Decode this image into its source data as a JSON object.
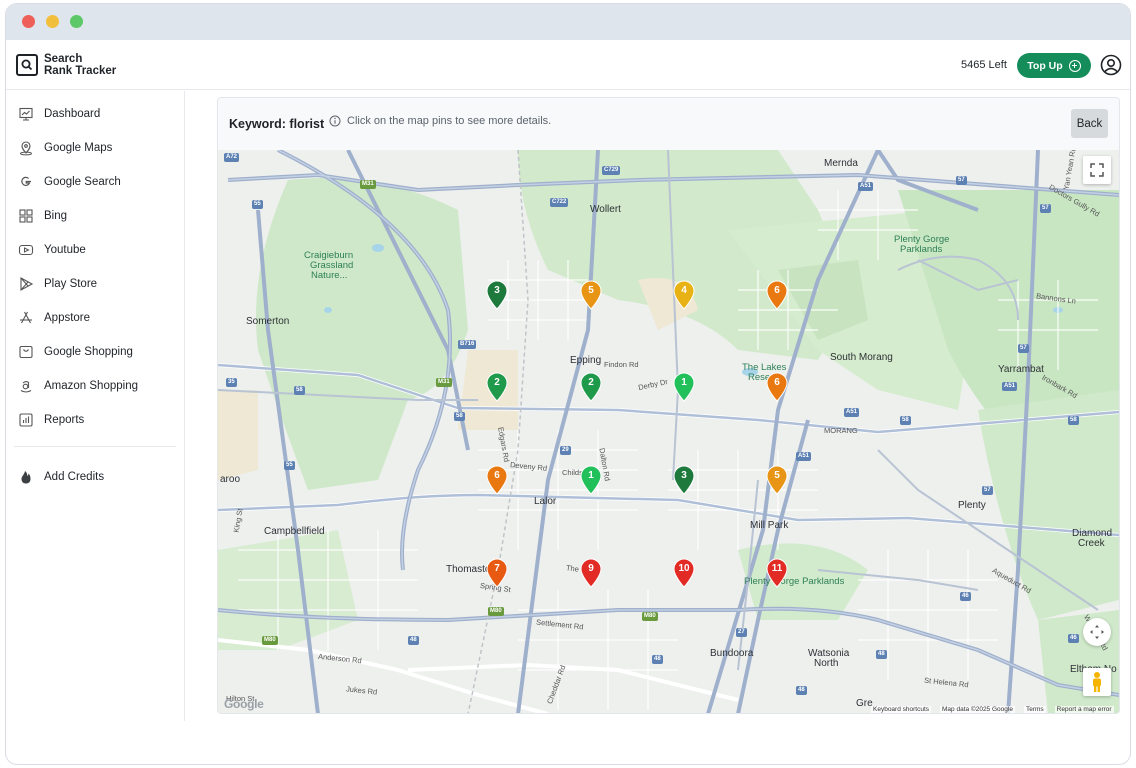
{
  "brand": {
    "line1": "Search",
    "line2": "Rank Tracker"
  },
  "header": {
    "credits": "5465 Left",
    "topup_label": "Top Up"
  },
  "sidebar": {
    "items": [
      {
        "label": "Dashboard",
        "icon": "dashboard-icon"
      },
      {
        "label": "Google Maps",
        "icon": "map-pin-icon"
      },
      {
        "label": "Google Search",
        "icon": "google-icon"
      },
      {
        "label": "Bing",
        "icon": "bing-icon"
      },
      {
        "label": "Youtube",
        "icon": "youtube-icon"
      },
      {
        "label": "Play Store",
        "icon": "play-store-icon"
      },
      {
        "label": "Appstore",
        "icon": "appstore-icon"
      },
      {
        "label": "Google Shopping",
        "icon": "shopping-icon"
      },
      {
        "label": "Amazon Shopping",
        "icon": "amazon-icon"
      },
      {
        "label": "Reports",
        "icon": "reports-icon"
      }
    ],
    "add_credits": {
      "label": "Add Credits",
      "icon": "flame-icon"
    }
  },
  "panel": {
    "keyword": "Keyword: florist",
    "hint": "Click on the map pins to see more details.",
    "back_label": "Back"
  },
  "map": {
    "places": {
      "wollert": "Wollert",
      "mernda": "Mernda",
      "craigieburn": "Craigieburn",
      "grassland1": "Grassland",
      "nature": "Nature...",
      "somerton": "Somerton",
      "epping": "Epping",
      "south_morang": "South Morang",
      "the_lakes": "The Lakes",
      "reserve": "Reserve",
      "yarrambat": "Yarrambat",
      "plenty_gorge1": "Plenty Gorge",
      "parklands1": "Parklands",
      "lalor": "Lalor",
      "mill_park": "Mill Park",
      "plenty": "Plenty",
      "diamond": "Diamond",
      "creek": "Creek",
      "campbellfield": "Campbellfield",
      "aroo": "aroo",
      "thomastown": "Thomastown",
      "plenty_gorge_parklands": "Plenty Gorge Parklands",
      "bundoora": "Bundoora",
      "watsonia": "Watsonia",
      "north": "North",
      "eltham": "Eltham No",
      "morang": "MORANG",
      "gre": "Gre"
    },
    "streets": {
      "findon": "Findon Rd",
      "derby": "Derby Dr",
      "deveny": "Deveny Rd",
      "childs": "Childs",
      "edgars": "Edgars Rd",
      "dalton": "Dalton Rd",
      "settlement": "Settlement Rd",
      "anderson": "Anderson Rd",
      "jukes": "Jukes Rd",
      "cheddar": "Cheddar Rd",
      "spring": "Spring St",
      "the": "The",
      "king": "King St",
      "hilton": "Hilton St",
      "bannons": "Bannons Ln",
      "ironbark": "Ironbark Rd",
      "doctors_gully": "Doctors Gully Rd",
      "yan_yean": "Yan Yean Rd",
      "aqueduct": "Aqueduct Rd",
      "st_helena": "St Helena Rd",
      "weidlich": "Weidlich Rd"
    },
    "shields": [
      "M31",
      "M31",
      "M80",
      "M80",
      "M80",
      "A72",
      "C729",
      "C722",
      "B716",
      "A51",
      "A51",
      "A51",
      "A51",
      "35",
      "55",
      "55",
      "58",
      "58",
      "58",
      "58",
      "29",
      "27",
      "57",
      "57",
      "57",
      "57",
      "46",
      "46",
      "48",
      "48",
      "48",
      "48"
    ],
    "pins": [
      {
        "rank": "3",
        "color": "#1e7a3c"
      },
      {
        "rank": "5",
        "color": "#e89414"
      },
      {
        "rank": "4",
        "color": "#e8b214"
      },
      {
        "rank": "6",
        "color": "#e8780f"
      },
      {
        "rank": "2",
        "color": "#1f9a4a"
      },
      {
        "rank": "2",
        "color": "#1f9a4a"
      },
      {
        "rank": "1",
        "color": "#22c05a"
      },
      {
        "rank": "6",
        "color": "#e8780f"
      },
      {
        "rank": "6",
        "color": "#e8780f"
      },
      {
        "rank": "1",
        "color": "#22c05a"
      },
      {
        "rank": "3",
        "color": "#1e7a3c"
      },
      {
        "rank": "5",
        "color": "#e89414"
      },
      {
        "rank": "7",
        "color": "#e85a12"
      },
      {
        "rank": "9",
        "color": "#e12b24"
      },
      {
        "rank": "10",
        "color": "#e12b24"
      },
      {
        "rank": "11",
        "color": "#e12b24"
      }
    ],
    "footer": {
      "shortcuts": "Keyboard shortcuts",
      "mapdata": "Map data ©2025 Google",
      "terms": "Terms",
      "report": "Report a map error"
    },
    "logo": "Google"
  }
}
